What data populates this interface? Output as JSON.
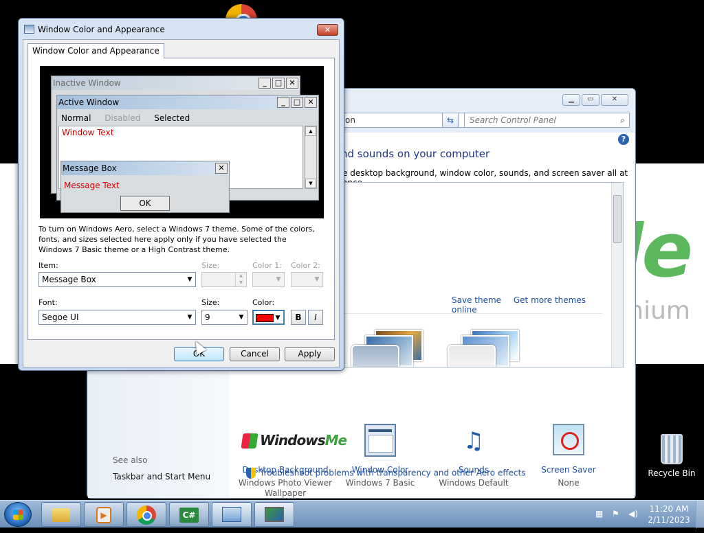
{
  "dialog": {
    "title": "Window Color and Appearance",
    "close_glyph": "✕",
    "tab_label": "Window Color and Appearance",
    "preview": {
      "inactive_title": "Inactive Window",
      "active_title": "Active Window",
      "menu_normal": "Normal",
      "menu_disabled": "Disabled",
      "menu_selected": "Selected",
      "window_text": "Window Text",
      "msgbox_title": "Message Box",
      "msgbox_text": "Message Text",
      "msgbox_ok": "OK",
      "btn_min": "_",
      "btn_max": "□",
      "btn_close": "✕"
    },
    "description": "To turn on Windows Aero, select a Windows 7 theme.  Some of the colors, fonts, and sizes selected here apply only if you have selected the Windows 7 Basic theme or a High Contrast theme.",
    "item_label": "Item:",
    "item_value": "Message Box",
    "size_label_1": "Size:",
    "size_value_1": "",
    "color1_label": "Color 1:",
    "color2_label": "Color 2:",
    "font_label": "Font:",
    "font_value": "Segoe UI",
    "size_label_2": "Size:",
    "size_value_2": "9",
    "color_label": "Color:",
    "color_value": "#ff0000",
    "bold_label": "B",
    "italic_label": "I",
    "ok_label": "OK",
    "cancel_label": "Cancel",
    "apply_label": "Apply"
  },
  "control_panel": {
    "address_fragment": "on",
    "search_placeholder": "Search Control Panel",
    "heading": "nd sounds on your computer",
    "subheading": "e desktop background, window color, sounds, and screen saver all at once.",
    "save_theme": "Save theme",
    "get_more_themes": "Get more themes online",
    "items": [
      {
        "label": "Desktop Background",
        "sub": "Windows Photo Viewer Wallpaper",
        "icon": "windows-me-wallpaper-icon"
      },
      {
        "label": "Window Color",
        "sub": "Windows 7 Basic",
        "icon": "window-color-icon"
      },
      {
        "label": "Sounds",
        "sub": "Windows Default",
        "icon": "sounds-icon"
      },
      {
        "label": "Screen Saver",
        "sub": "None",
        "icon": "screen-saver-icon"
      }
    ],
    "winme_logo_windows": "Windows",
    "winme_logo_me": "Me",
    "see_also": "See also",
    "taskbar_link": "Taskbar and Start Menu",
    "troubleshoot": "Troubleshoot problems with transparency and other Aero effects",
    "help": "?"
  },
  "desktop": {
    "wallpaper_me": "Me",
    "wallpaper_sub": "nium",
    "recycle_bin": "Recycle Bin"
  },
  "taskbar": {
    "time": "11:20 AM",
    "date": "2/11/2023",
    "cs_label": "C#"
  }
}
